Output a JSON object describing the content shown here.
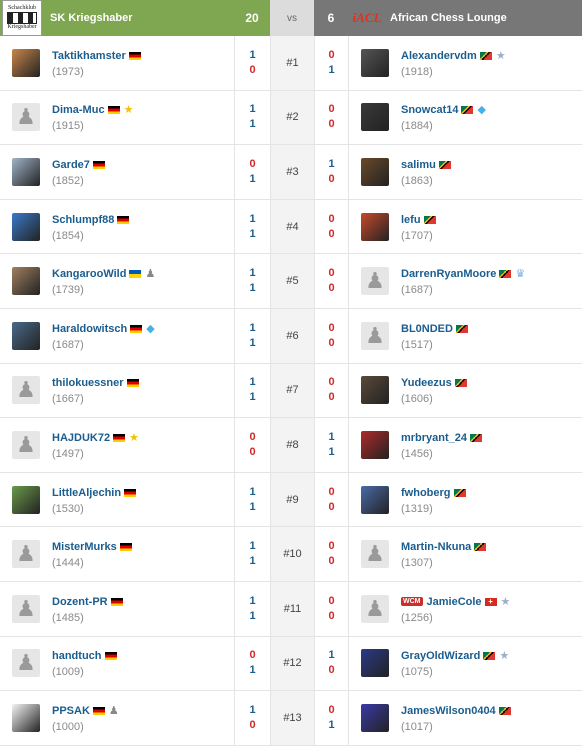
{
  "header": {
    "left_logo_text": [
      "Schachklub",
      "Kriegshaber"
    ],
    "left_team": "SK Kriegshaber",
    "left_score": "20",
    "vs": "vs",
    "right_score": "6",
    "right_logo_text": "iACL",
    "right_team": "African Chess Lounge"
  },
  "rows": [
    {
      "board": "#1",
      "left": {
        "name": "Taktikhamster",
        "rating": "(1973)",
        "flag": "de",
        "badge": "",
        "avatar": "photo",
        "avatar_color": "#c8864a"
      },
      "lscores": [
        "1",
        "0"
      ],
      "rscores": [
        "0",
        "1"
      ],
      "right": {
        "name": "Alexandervdm",
        "rating": "(1918)",
        "flag": "za",
        "badge": "star-silver",
        "avatar": "photo",
        "avatar_color": "#555"
      }
    },
    {
      "board": "#2",
      "left": {
        "name": "Dima-Muc",
        "rating": "(1915)",
        "flag": "de",
        "badge": "star-gold",
        "avatar": "default"
      },
      "lscores": [
        "1",
        "1"
      ],
      "rscores": [
        "0",
        "0"
      ],
      "right": {
        "name": "Snowcat14",
        "rating": "(1884)",
        "flag": "za",
        "badge": "diamond",
        "avatar": "photo",
        "avatar_color": "#3a3a3a"
      }
    },
    {
      "board": "#3",
      "left": {
        "name": "Garde7",
        "rating": "(1852)",
        "flag": "de",
        "badge": "",
        "avatar": "photo",
        "avatar_color": "#a0b4c8"
      },
      "lscores": [
        "0",
        "1"
      ],
      "rscores": [
        "1",
        "0"
      ],
      "right": {
        "name": "salimu",
        "rating": "(1863)",
        "flag": "za",
        "badge": "",
        "avatar": "photo",
        "avatar_color": "#6a4a2a"
      }
    },
    {
      "board": "#4",
      "left": {
        "name": "Schlumpf88",
        "rating": "(1854)",
        "flag": "de",
        "badge": "",
        "avatar": "photo",
        "avatar_color": "#3a7ac8"
      },
      "lscores": [
        "1",
        "1"
      ],
      "rscores": [
        "0",
        "0"
      ],
      "right": {
        "name": "lefu",
        "rating": "(1707)",
        "flag": "za",
        "badge": "",
        "avatar": "photo",
        "avatar_color": "#c84a2a"
      }
    },
    {
      "board": "#5",
      "left": {
        "name": "KangarooWild",
        "rating": "(1739)",
        "flag": "ua",
        "badge": "grey-piece",
        "avatar": "photo",
        "avatar_color": "#a08060"
      },
      "lscores": [
        "1",
        "1"
      ],
      "rscores": [
        "0",
        "0"
      ],
      "right": {
        "name": "DarrenRyanMoore",
        "rating": "(1687)",
        "flag": "za",
        "badge": "crown",
        "avatar": "default"
      }
    },
    {
      "board": "#6",
      "left": {
        "name": "Haraldowitsch",
        "rating": "(1687)",
        "flag": "de",
        "badge": "diamond",
        "avatar": "photo",
        "avatar_color": "#4a6a8a"
      },
      "lscores": [
        "1",
        "1"
      ],
      "rscores": [
        "0",
        "0"
      ],
      "right": {
        "name": "BL0NDED",
        "rating": "(1517)",
        "flag": "za",
        "badge": "",
        "avatar": "default"
      }
    },
    {
      "board": "#7",
      "left": {
        "name": "thilokuessner",
        "rating": "(1667)",
        "flag": "de",
        "badge": "",
        "avatar": "default"
      },
      "lscores": [
        "1",
        "1"
      ],
      "rscores": [
        "0",
        "0"
      ],
      "right": {
        "name": "Yudeezus",
        "rating": "(1606)",
        "flag": "za",
        "badge": "",
        "avatar": "photo",
        "avatar_color": "#5a4a3a"
      }
    },
    {
      "board": "#8",
      "left": {
        "name": "HAJDUK72",
        "rating": "(1497)",
        "flag": "de",
        "badge": "star-gold",
        "avatar": "default"
      },
      "lscores": [
        "0",
        "0"
      ],
      "rscores": [
        "1",
        "1"
      ],
      "right": {
        "name": "mrbryant_24",
        "rating": "(1456)",
        "flag": "za",
        "badge": "",
        "avatar": "photo",
        "avatar_color": "#b02a2a"
      }
    },
    {
      "board": "#9",
      "left": {
        "name": "LittleAljechin",
        "rating": "(1530)",
        "flag": "de",
        "badge": "",
        "avatar": "photo",
        "avatar_color": "#6a9a4a"
      },
      "lscores": [
        "1",
        "1"
      ],
      "rscores": [
        "0",
        "0"
      ],
      "right": {
        "name": "fwhoberg",
        "rating": "(1319)",
        "flag": "za",
        "badge": "",
        "avatar": "photo",
        "avatar_color": "#4a6aa8"
      }
    },
    {
      "board": "#10",
      "left": {
        "name": "MisterMurks",
        "rating": "(1444)",
        "flag": "de",
        "badge": "",
        "avatar": "default"
      },
      "lscores": [
        "1",
        "1"
      ],
      "rscores": [
        "0",
        "0"
      ],
      "right": {
        "name": "Martin-Nkuna",
        "rating": "(1307)",
        "flag": "za",
        "badge": "",
        "avatar": "default"
      }
    },
    {
      "board": "#11",
      "left": {
        "name": "Dozent-PR",
        "rating": "(1485)",
        "flag": "de",
        "badge": "",
        "avatar": "default"
      },
      "lscores": [
        "1",
        "1"
      ],
      "rscores": [
        "0",
        "0"
      ],
      "right": {
        "name": "JamieCole",
        "rating": "(1256)",
        "flag": "ch",
        "badge": "star-silver",
        "title": "WCM",
        "avatar": "default"
      }
    },
    {
      "board": "#12",
      "left": {
        "name": "handtuch",
        "rating": "(1009)",
        "flag": "de",
        "badge": "",
        "avatar": "default"
      },
      "lscores": [
        "0",
        "1"
      ],
      "rscores": [
        "1",
        "0"
      ],
      "right": {
        "name": "GrayOldWizard",
        "rating": "(1075)",
        "flag": "za",
        "badge": "star-silver",
        "avatar": "photo",
        "avatar_color": "#2a3a8a"
      }
    },
    {
      "board": "#13",
      "left": {
        "name": "PPSAK",
        "rating": "(1000)",
        "flag": "de",
        "badge": "grey-piece",
        "avatar": "photo",
        "avatar_color": "#f4f4f4"
      },
      "lscores": [
        "1",
        "0"
      ],
      "rscores": [
        "0",
        "1"
      ],
      "right": {
        "name": "JamesWilson0404",
        "rating": "(1017)",
        "flag": "za",
        "badge": "",
        "avatar": "photo",
        "avatar_color": "#3a3aa8"
      }
    }
  ]
}
